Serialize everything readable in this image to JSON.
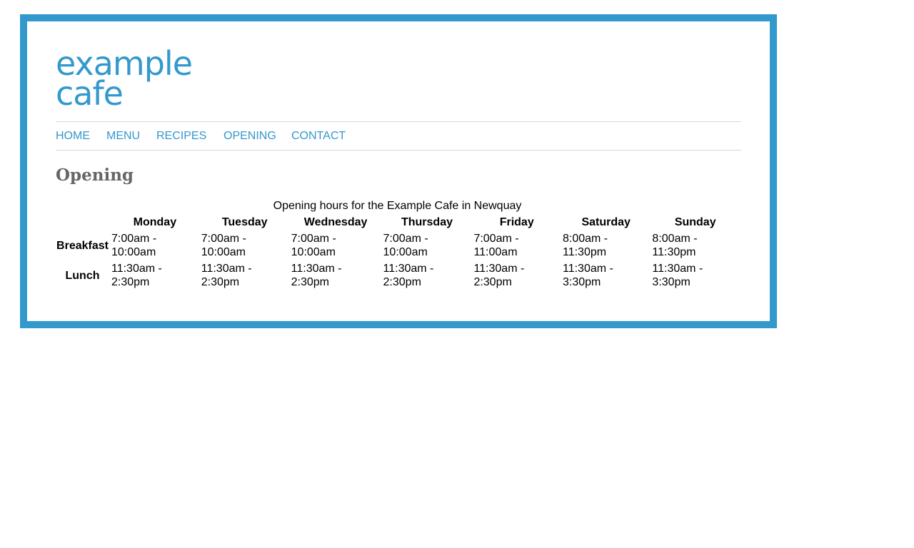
{
  "logo": {
    "line1": "example",
    "line2": "cafe"
  },
  "colors": {
    "accent": "#3399cc",
    "heading": "#666666",
    "rule": "#d6d6d6"
  },
  "nav": [
    {
      "label": "HOME"
    },
    {
      "label": "MENU"
    },
    {
      "label": "RECIPES"
    },
    {
      "label": "OPENING"
    },
    {
      "label": "CONTACT"
    }
  ],
  "page_title": "Opening",
  "hours_table": {
    "caption": "Opening hours for the Example Cafe in Newquay",
    "days": [
      "Monday",
      "Tuesday",
      "Wednesday",
      "Thursday",
      "Friday",
      "Saturday",
      "Sunday"
    ],
    "rows": [
      {
        "label": "Breakfast",
        "cells": [
          "7:00am - 10:00am",
          "7:00am - 10:00am",
          "7:00am - 10:00am",
          "7:00am - 10:00am",
          "7:00am - 11:00am",
          "8:00am - 11:30pm",
          "8:00am - 11:30pm"
        ]
      },
      {
        "label": "Lunch",
        "cells": [
          "11:30am - 2:30pm",
          "11:30am - 2:30pm",
          "11:30am - 2:30pm",
          "11:30am - 2:30pm",
          "11:30am - 2:30pm",
          "11:30am - 3:30pm",
          "11:30am - 3:30pm"
        ]
      }
    ]
  }
}
